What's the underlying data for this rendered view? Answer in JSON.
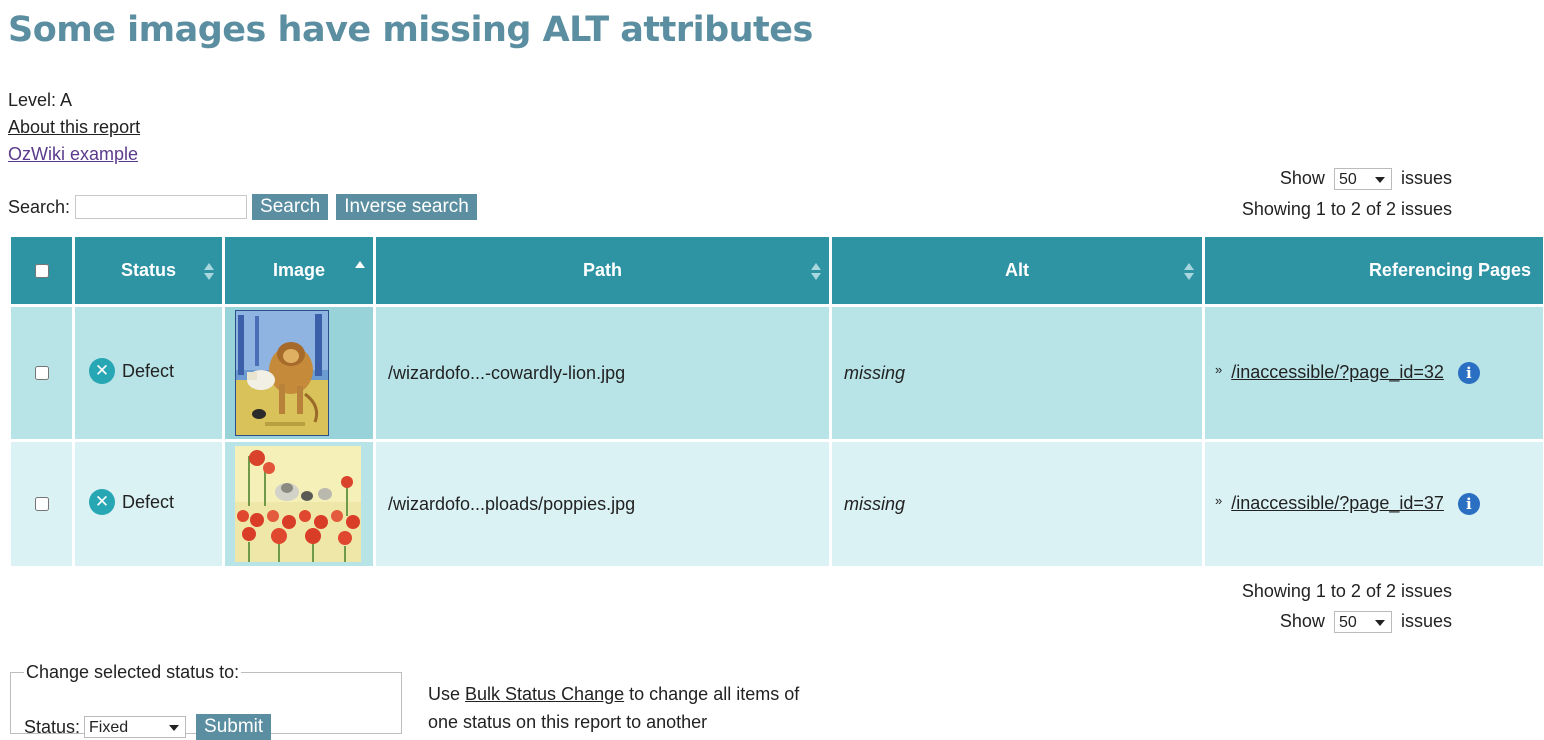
{
  "page": {
    "title": "Some images have missing ALT attributes",
    "level": "Level: A",
    "about_link": "About this report",
    "example_link": "OzWiki example"
  },
  "search": {
    "label": "Search:",
    "value": "",
    "search_button": "Search",
    "inverse_button": "Inverse search"
  },
  "pager_top": {
    "show_label": "Show",
    "show_value": "50",
    "issues_label": "issues",
    "summary": "Showing 1 to 2 of 2 issues"
  },
  "pager_bottom": {
    "show_label": "Show",
    "show_value": "50",
    "issues_label": "issues",
    "summary": "Showing 1 to 2 of 2 issues"
  },
  "table": {
    "headers": {
      "status": "Status",
      "image": "Image",
      "path": "Path",
      "alt": "Alt",
      "ref": "Referencing Pages"
    },
    "sorted_by": "Image",
    "rows": [
      {
        "status": "Defect",
        "image_icon": "cowardly-lion-thumbnail",
        "path": "/wizardofo...-cowardly-lion.jpg",
        "alt": "missing",
        "ref": "/inaccessible/?page_id=32"
      },
      {
        "status": "Defect",
        "image_icon": "poppies-thumbnail",
        "path": "/wizardofo...ploads/poppies.jpg",
        "alt": "missing",
        "ref": "/inaccessible/?page_id=37"
      }
    ]
  },
  "bulk": {
    "legend": "Change selected status to:",
    "status_label": "Status:",
    "status_value": "Fixed",
    "submit": "Submit",
    "note_prefix": "Use ",
    "note_link": "Bulk Status Change",
    "note_suffix_line1": " to change all items of",
    "note_line2": "one status on this report to another"
  },
  "colors": {
    "title": "#5a8ea0",
    "header_bg": "#2e93a3",
    "row1_bg": "#b8e4e8",
    "row2_bg": "#daf2f4",
    "button_bg": "#5a8ea0"
  }
}
